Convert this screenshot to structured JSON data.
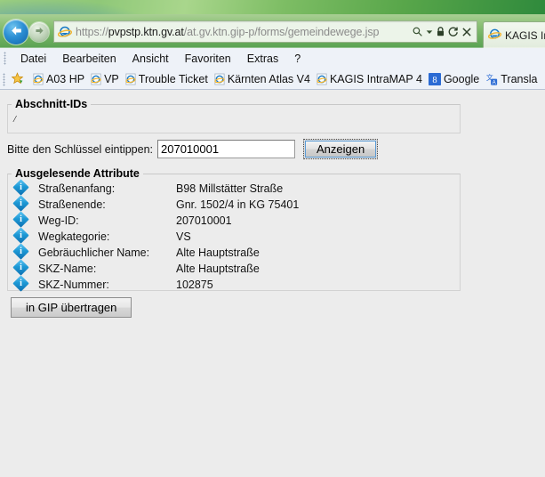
{
  "browser": {
    "back_title": "Zurück",
    "forward_title": "Vorwärts",
    "url_protocol": "https://",
    "url_host": "pvpstp.ktn.gv.at",
    "url_path": "/at.gv.ktn.gip-p/forms/gemeindewege.jsp",
    "url_full": "https://pvpstp.ktn.gv.at/at.gv.ktn.gip-p/forms/gemeindewege.jsp",
    "icons": {
      "search": "search-icon",
      "dropdown": "chevron-down-icon",
      "lock": "lock-icon",
      "refresh": "refresh-icon",
      "stop": "stop-icon",
      "ie_logo": "internet-explorer-icon"
    },
    "tab": {
      "label": "KAGIS In",
      "icon": "internet-explorer-icon"
    },
    "menu": [
      {
        "label": "Datei"
      },
      {
        "label": "Bearbeiten"
      },
      {
        "label": "Ansicht"
      },
      {
        "label": "Favoriten"
      },
      {
        "label": "Extras"
      },
      {
        "label": "?"
      }
    ],
    "favorites": [
      {
        "label": "A03 HP",
        "icon": "ie-page-icon"
      },
      {
        "label": "VP",
        "icon": "ie-page-icon"
      },
      {
        "label": "Trouble Ticket",
        "icon": "ie-page-icon"
      },
      {
        "label": "Kärnten Atlas V4",
        "icon": "ie-page-icon"
      },
      {
        "label": "KAGIS IntraMAP 4",
        "icon": "ie-page-icon"
      },
      {
        "label": "Google",
        "icon": "google-plus-icon"
      },
      {
        "label": "Transla",
        "icon": "translate-icon"
      }
    ]
  },
  "page": {
    "ids_fieldset": {
      "legend": "Abschnitt-IDs",
      "value": "/"
    },
    "key_row": {
      "label": "Bitte den Schlüssel eintippen:",
      "input_value": "207010001",
      "input_placeholder": "",
      "button_label": "Anzeigen"
    },
    "attributes_fieldset": {
      "legend": "Ausgelesende Attribute",
      "rows": [
        {
          "icon": "info-icon",
          "label": "Straßenanfang:",
          "value": "B98 Millstätter Straße"
        },
        {
          "icon": "info-icon",
          "label": "Straßenende:",
          "value": "Gnr. 1502/4 in KG 75401"
        },
        {
          "icon": "info-icon",
          "label": "Weg-ID:",
          "value": "207010001"
        },
        {
          "icon": "info-icon",
          "label": "Wegkategorie:",
          "value": "VS"
        },
        {
          "icon": "info-icon",
          "label": "Gebräuchlicher Name:",
          "value": "Alte Hauptstraße"
        },
        {
          "icon": "info-icon",
          "label": "SKZ-Name:",
          "value": "Alte Hauptstraße"
        },
        {
          "icon": "info-icon",
          "label": "SKZ-Nummer:",
          "value": "102875"
        }
      ]
    },
    "transfer_button": {
      "label": "in GIP übertragen"
    }
  },
  "colors": {
    "page_background": "#ececec",
    "chrome_green": "#74b263",
    "info_blue": "#1e9ad6",
    "toolbar_blue": "#eef2f8",
    "focus_outline": "#5b9bd5"
  }
}
